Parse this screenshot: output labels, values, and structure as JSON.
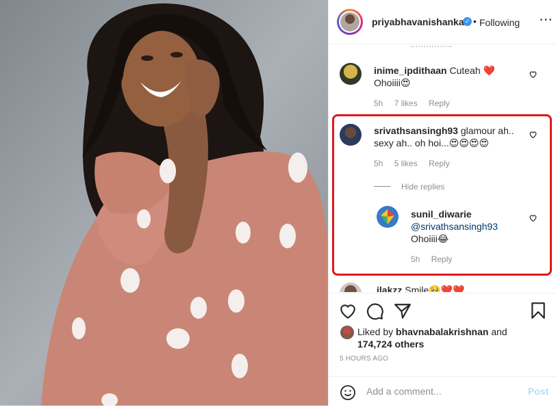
{
  "header": {
    "username": "priyabhavanishankar",
    "separator": "•",
    "following_label": "Following",
    "more_label": "⋯"
  },
  "comments": [
    {
      "username": "inime_ipdithaan",
      "text": "Cuteah ❤️",
      "line2": "Ohoiiii😍",
      "time": "5h",
      "likes": "7 likes",
      "reply": "Reply"
    },
    {
      "username": "srivathsansingh93",
      "text": "glamour ah..",
      "line2": "sexy ah.. oh hoi...😍😍😍😍",
      "time": "5h",
      "likes": "5 likes",
      "reply": "Reply",
      "hide_replies": "Hide replies",
      "replies": [
        {
          "username": "sunil_diwarie",
          "mention": "@srivathsansingh93",
          "text": "Ohoiiii😂",
          "time": "5h",
          "reply": "Reply"
        }
      ]
    },
    {
      "username": "ilakzz",
      "text": "Smile🥺❤️❤️"
    }
  ],
  "likes": {
    "prefix": "Liked by ",
    "user": "bhavnabalakrishnan",
    "conj": " and",
    "count": "174,724 others"
  },
  "time_ago": "5 HOURS AGO",
  "add_comment": {
    "placeholder": "Add a comment...",
    "post_label": "Post"
  },
  "colors": {
    "highlight_border": "#e0171b",
    "link": "#00376b",
    "verified": "#3897f0"
  },
  "icons": [
    "verified-icon",
    "heart-icon",
    "comment-icon",
    "share-icon",
    "bookmark-icon",
    "emoji-icon"
  ]
}
